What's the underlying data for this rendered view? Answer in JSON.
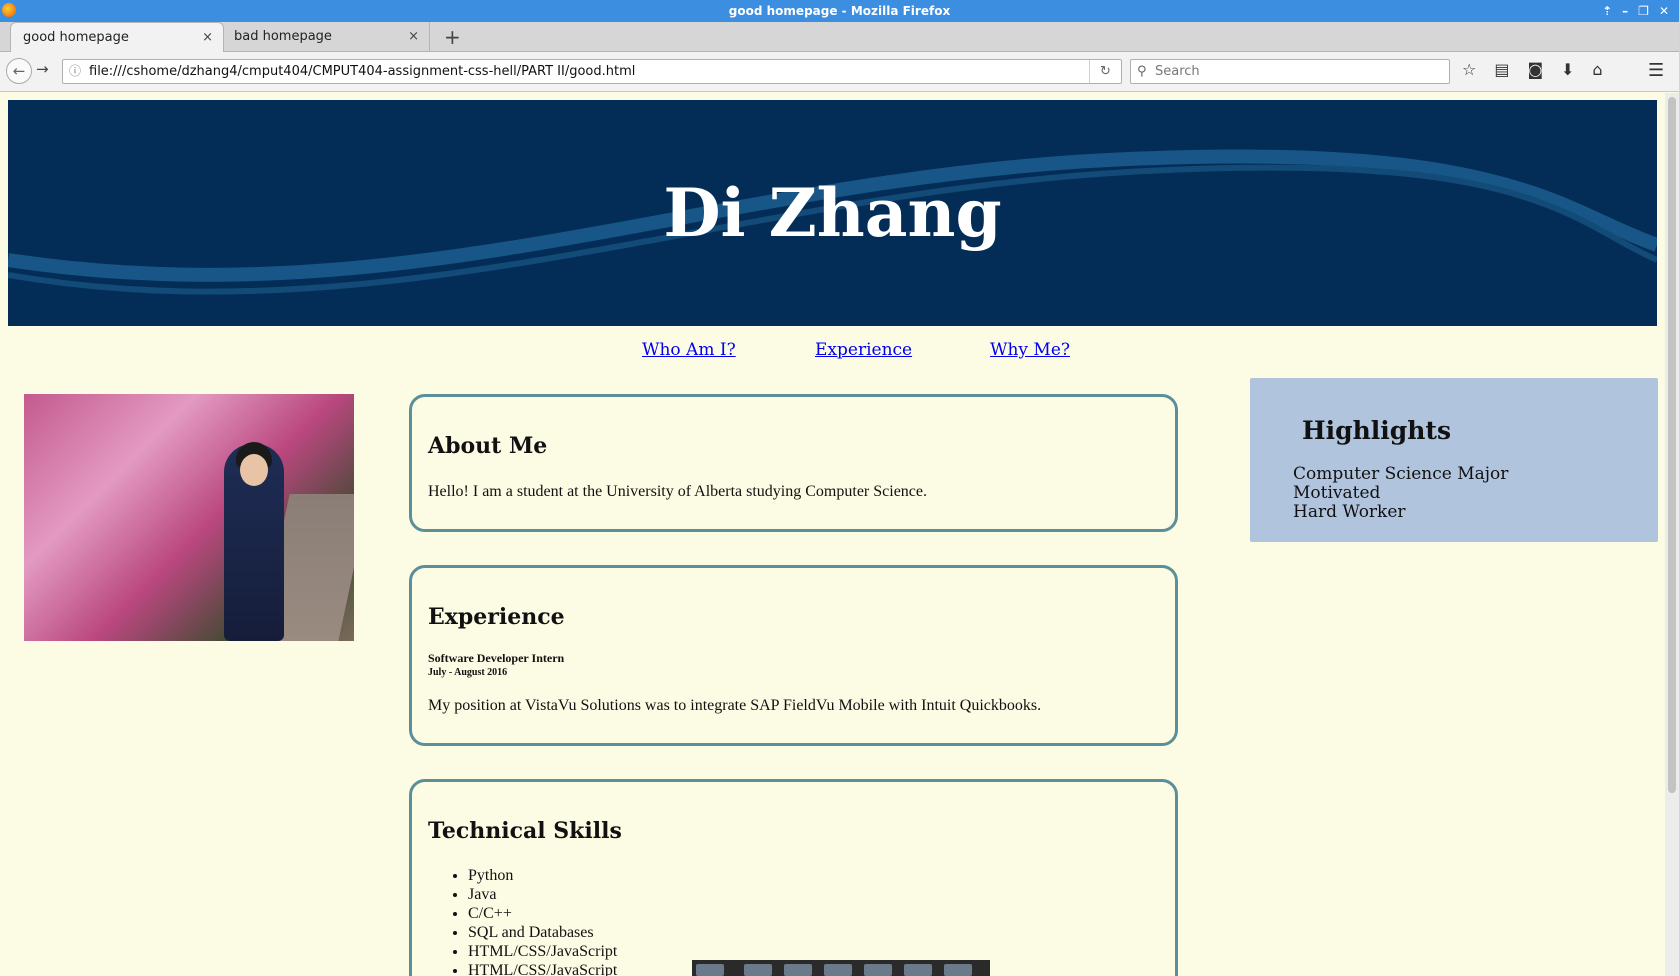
{
  "window": {
    "title": "good homepage - Mozilla Firefox"
  },
  "tabs": [
    {
      "label": "good homepage",
      "close": "×"
    },
    {
      "label": "bad homepage",
      "close": "×"
    }
  ],
  "new_tab": "+",
  "navbar": {
    "back": "←",
    "forward": "→",
    "url": "file:///cshome/dzhang4/cmput404/CMPUT404-assignment-css-hell/PART II/good.html",
    "reload": "↻",
    "search_placeholder": "Search"
  },
  "page": {
    "name": "Di Zhang",
    "nav_links": [
      "Who Am I?",
      "Experience",
      "Why Me?"
    ],
    "about": {
      "heading": "About Me",
      "text": "Hello! I am a student at the University of Alberta studying Computer Science."
    },
    "experience": {
      "heading": "Experience",
      "job_title": "Software Developer Intern",
      "job_date": "July - August 2016",
      "text": "My position at VistaVu Solutions was to integrate SAP FieldVu Mobile with Intuit Quickbooks."
    },
    "skills": {
      "heading": "Technical Skills",
      "items": [
        "Python",
        "Java",
        "C/C++",
        "SQL and Databases",
        "HTML/CSS/JavaScript",
        "HTML/CSS/JavaScript"
      ]
    },
    "highlights": {
      "heading": "Highlights",
      "items": [
        "Computer Science Major",
        "Motivated",
        "Hard Worker"
      ]
    }
  },
  "colors": {
    "banner": "#032d57",
    "card_border": "#5b8f99",
    "sidebar": "#b0c4de",
    "page_bg": "#fcfbe4"
  }
}
